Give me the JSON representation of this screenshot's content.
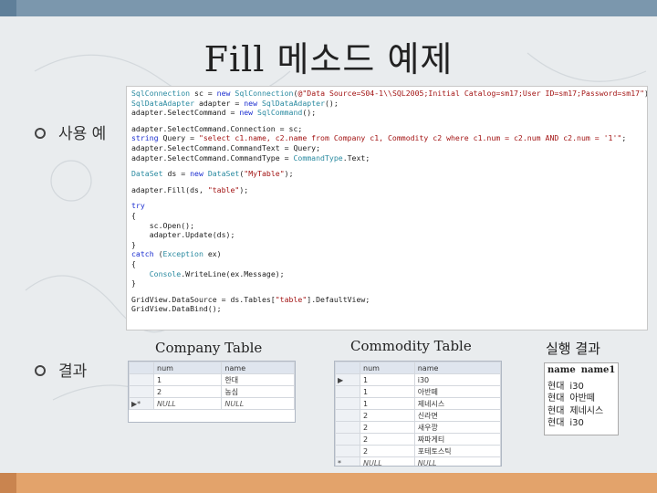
{
  "slide": {
    "title": "Fill 메소드 예제"
  },
  "bullets": {
    "usage_label": "사용 예",
    "result_label": "결과"
  },
  "code": {
    "lines": [
      [
        {
          "t": "SqlConnection",
          "c": "ty"
        },
        {
          "t": " sc = "
        },
        {
          "t": "new",
          "c": "kw"
        },
        {
          "t": " "
        },
        {
          "t": "SqlConnection",
          "c": "ty"
        },
        {
          "t": "("
        },
        {
          "t": "@\"Data Source=S04-1\\\\SQL2005;Initial Catalog=sm17;User ID=sm17;Password=sm17\"",
          "c": "st"
        },
        {
          "t": ");"
        }
      ],
      [
        {
          "t": "SqlDataAdapter",
          "c": "ty"
        },
        {
          "t": " adapter = "
        },
        {
          "t": "new",
          "c": "kw"
        },
        {
          "t": " "
        },
        {
          "t": "SqlDataAdapter",
          "c": "ty"
        },
        {
          "t": "();"
        }
      ],
      [
        {
          "t": "adapter.SelectCommand = "
        },
        {
          "t": "new",
          "c": "kw"
        },
        {
          "t": " "
        },
        {
          "t": "SqlCommand",
          "c": "ty"
        },
        {
          "t": "();"
        }
      ],
      [],
      [
        {
          "t": "adapter.SelectCommand.Connection = sc;"
        }
      ],
      [
        {
          "t": "string",
          "c": "kw"
        },
        {
          "t": " Query = "
        },
        {
          "t": "\"select c1.name, c2.name from Company c1, Commodity c2 where c1.num = c2.num AND c2.num = '1'\"",
          "c": "st"
        },
        {
          "t": ";"
        }
      ],
      [
        {
          "t": "adapter.SelectCommand.CommandText = Query;"
        }
      ],
      [
        {
          "t": "adapter.SelectCommand.CommandType = "
        },
        {
          "t": "CommandType",
          "c": "ty"
        },
        {
          "t": ".Text;"
        }
      ],
      [],
      [
        {
          "t": "DataSet",
          "c": "ty"
        },
        {
          "t": " ds = "
        },
        {
          "t": "new",
          "c": "kw"
        },
        {
          "t": " "
        },
        {
          "t": "DataSet",
          "c": "ty"
        },
        {
          "t": "("
        },
        {
          "t": "\"MyTable\"",
          "c": "st"
        },
        {
          "t": ");"
        }
      ],
      [],
      [
        {
          "t": "adapter.Fill(ds, "
        },
        {
          "t": "\"table\"",
          "c": "st"
        },
        {
          "t": ");"
        }
      ],
      [],
      [
        {
          "t": "try",
          "c": "kw"
        }
      ],
      [
        {
          "t": "{"
        }
      ],
      [
        {
          "t": "    sc.Open();"
        }
      ],
      [
        {
          "t": "    adapter.Update(ds);"
        }
      ],
      [
        {
          "t": "}"
        }
      ],
      [
        {
          "t": "catch",
          "c": "kw"
        },
        {
          "t": " ("
        },
        {
          "t": "Exception",
          "c": "ty"
        },
        {
          "t": " ex)"
        }
      ],
      [
        {
          "t": "{"
        }
      ],
      [
        {
          "t": "    "
        },
        {
          "t": "Console",
          "c": "ty"
        },
        {
          "t": ".WriteLine(ex.Message);"
        }
      ],
      [
        {
          "t": "}"
        }
      ],
      [],
      [
        {
          "t": "GridView.DataSource = ds.Tables["
        },
        {
          "t": "\"table\"",
          "c": "st"
        },
        {
          "t": "].DefaultView;"
        }
      ],
      [
        {
          "t": "GridView.DataBind();"
        }
      ]
    ]
  },
  "company_table": {
    "caption": "Company Table",
    "columns": [
      "num",
      "name"
    ],
    "rows": [
      {
        "marker": "",
        "cells": [
          "1",
          "한대"
        ]
      },
      {
        "marker": "",
        "cells": [
          "2",
          "농심"
        ]
      },
      {
        "marker": "▶*",
        "cells": [
          "NULL",
          "NULL"
        ]
      }
    ]
  },
  "commodity_table": {
    "caption": "Commodity Table",
    "columns": [
      "num",
      "name"
    ],
    "rows": [
      {
        "marker": "▶",
        "cells": [
          "1",
          "i30"
        ]
      },
      {
        "marker": "",
        "cells": [
          "1",
          "아반떼"
        ]
      },
      {
        "marker": "",
        "cells": [
          "1",
          "제네시스"
        ]
      },
      {
        "marker": "",
        "cells": [
          "2",
          "신라면"
        ]
      },
      {
        "marker": "",
        "cells": [
          "2",
          "새우깡"
        ]
      },
      {
        "marker": "",
        "cells": [
          "2",
          "짜파게티"
        ]
      },
      {
        "marker": "",
        "cells": [
          "2",
          "포테토스틱"
        ]
      },
      {
        "marker": "*",
        "cells": [
          "NULL",
          "NULL"
        ]
      }
    ]
  },
  "result_table": {
    "caption": "실행 결과",
    "columns": [
      "name",
      "name1"
    ],
    "rows": [
      [
        "현대",
        "i30"
      ],
      [
        "현대",
        "아반떼"
      ],
      [
        "현대",
        "제네시스"
      ],
      [
        "현대",
        "i30"
      ]
    ]
  },
  "colors": {
    "top_bar": "#7b97ad",
    "bottom_bar": "#e3a36b",
    "keyword": "#1c2fd0",
    "type": "#2a8aa0",
    "string": "#a31515"
  }
}
